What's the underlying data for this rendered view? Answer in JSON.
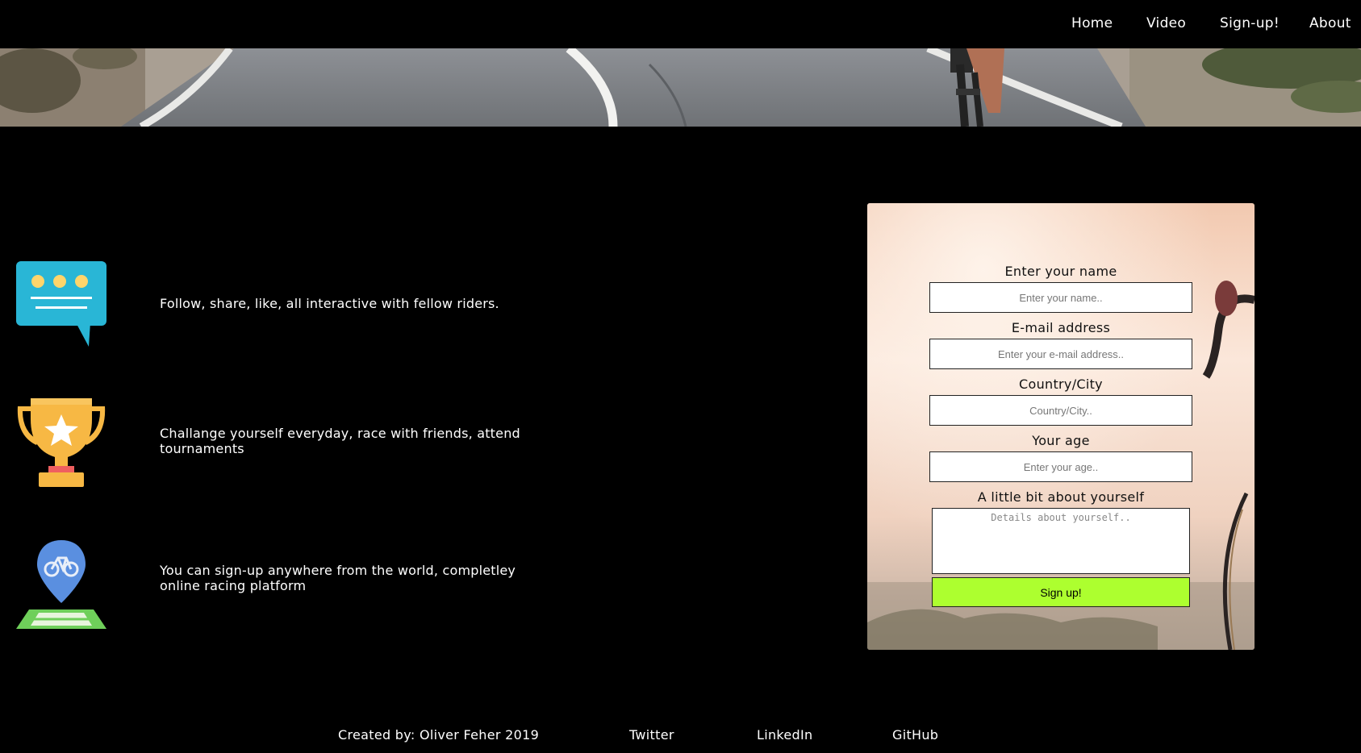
{
  "nav": {
    "items": [
      {
        "label": "Home"
      },
      {
        "label": "Video"
      },
      {
        "label": "Sign-up!"
      },
      {
        "label": "About"
      }
    ]
  },
  "hero": {
    "icon": "road-cyclist-banner"
  },
  "features": [
    {
      "icon": "chat-bubble-icon",
      "text": "Follow, share, like, all interactive with fellow riders."
    },
    {
      "icon": "trophy-icon",
      "text": "Challange yourself everyday, race with friends, attend tournaments"
    },
    {
      "icon": "map-pin-bike-icon",
      "text": "You can sign-up anywhere from the world, completley online racing platform"
    }
  ],
  "form": {
    "name_label": "Enter your name",
    "name_placeholder": "Enter your name..",
    "email_label": "E-mail address",
    "email_placeholder": "Enter your e-mail address..",
    "country_label": "Country/City",
    "country_placeholder": "Country/City..",
    "age_label": "Your age",
    "age_placeholder": "Enter your age..",
    "about_label": "A little bit about yourself",
    "about_placeholder": "Details about yourself..",
    "submit_label": "Sign up!",
    "submit_color": "#adff2f"
  },
  "footer": {
    "credit": "Created by: Oliver Feher 2019",
    "links": [
      {
        "label": "Twitter"
      },
      {
        "label": "LinkedIn"
      },
      {
        "label": "GitHub"
      }
    ]
  },
  "colors": {
    "background": "#000000",
    "text": "#ffffff",
    "chat_icon": "#29b6d6",
    "trophy_icon": "#f7b844",
    "pin_icon": "#5a8fe0"
  }
}
